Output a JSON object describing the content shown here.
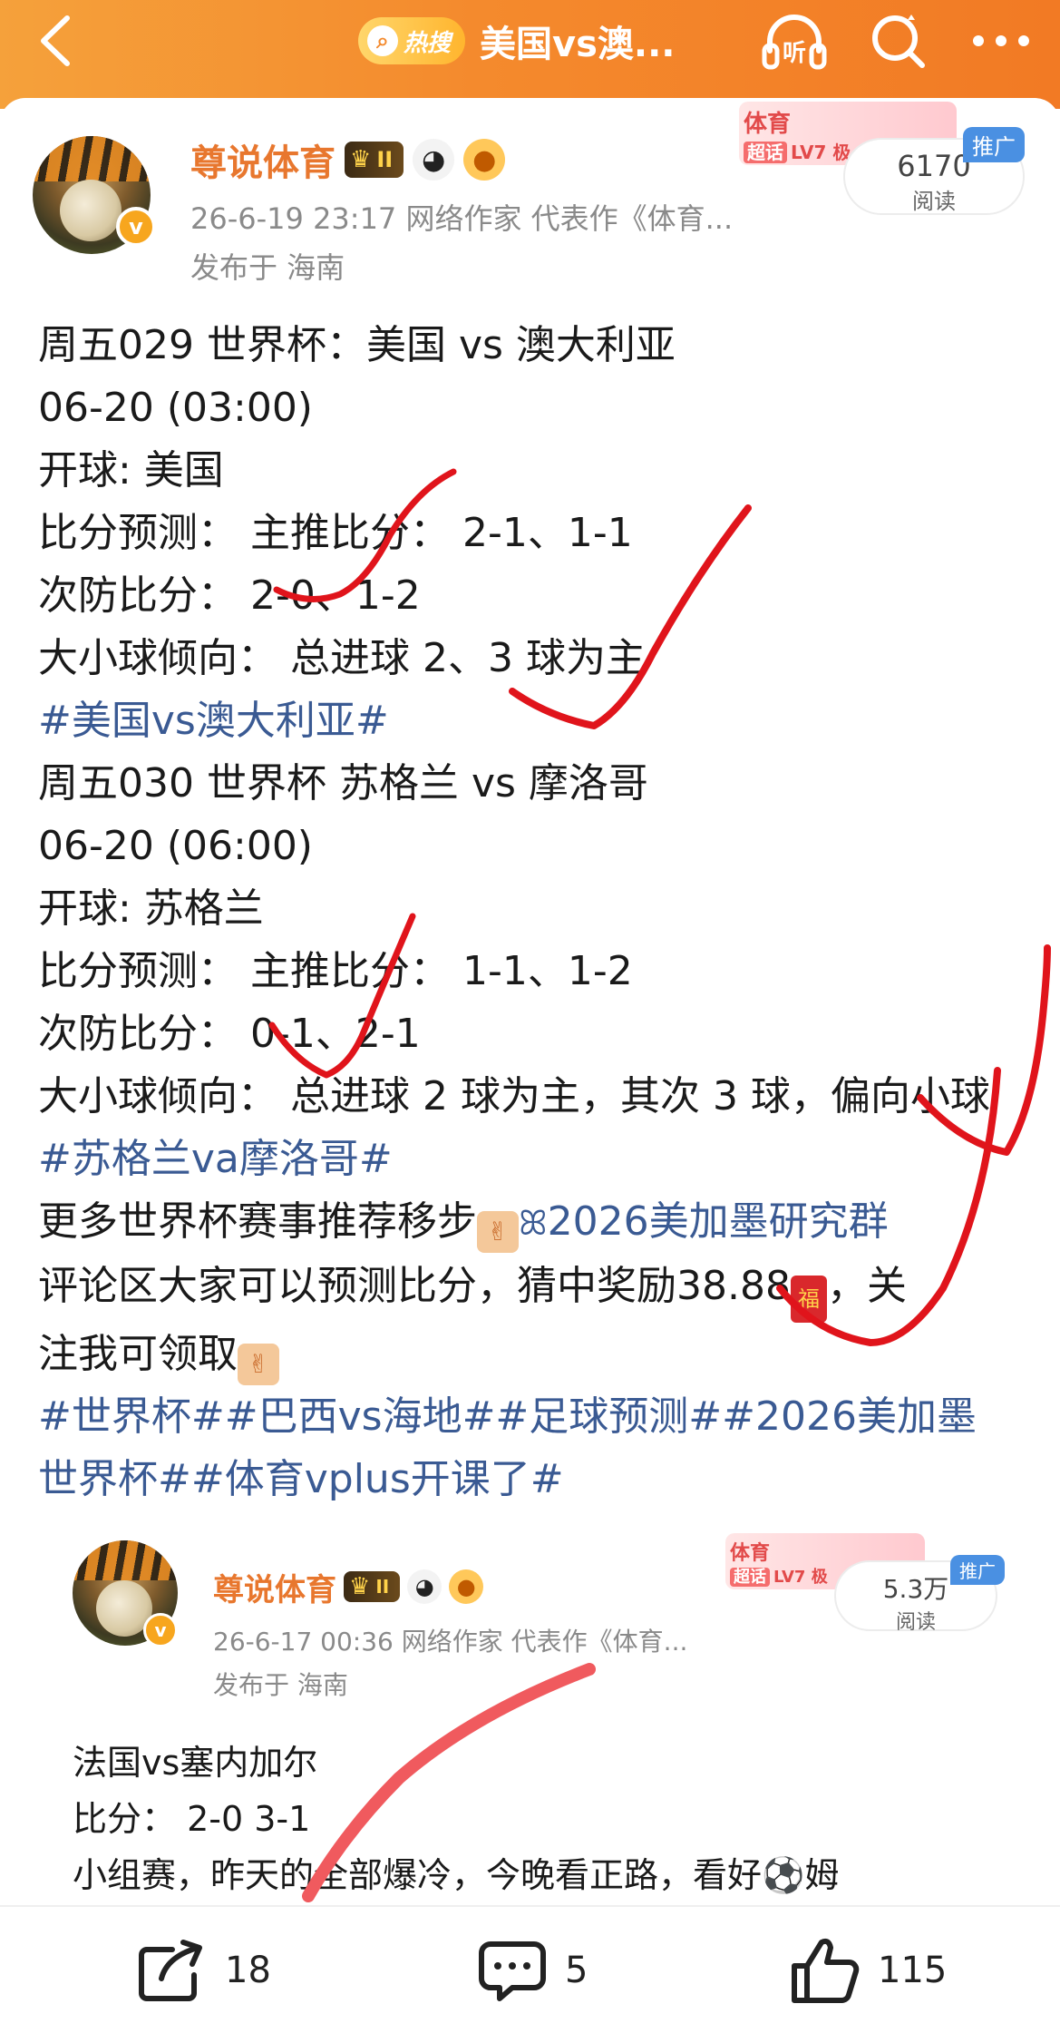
{
  "header": {
    "hot_badge": "热搜",
    "title": "美国vs澳...",
    "icons": [
      "back-icon",
      "listen-icon",
      "search-icon",
      "more-icon"
    ],
    "listen_label": "听"
  },
  "post": {
    "author": "尊说体育",
    "level_badge": "II",
    "meta": "26-6-19 23:17  网络作家 代表作《体育...",
    "location": "发布于 海南",
    "ad": {
      "label": "体育",
      "sub_chip": "超话",
      "sub_text": "LV7 极",
      "reads": "6170",
      "reads_label": "阅读",
      "promo": "推广"
    },
    "lines": [
      "周五029 世界杯：美国 vs 澳大利亚",
      "06-20 (03:00)",
      "开球: 美国",
      "比分预测：  主推比分：  2-1、1-1",
      "次防比分：  2-0、1-2",
      "大小球倾向：  总进球 2、3 球为主"
    ],
    "tag1": "#美国vs澳大利亚#",
    "lines2": [
      "周五030 世界杯 苏格兰 vs 摩洛哥",
      "06-20 (06:00)",
      "开球: 苏格兰",
      "比分预测：  主推比分：  1-1、1-2",
      "次防比分：  0-1、2-1",
      "大小球倾向：  总进球 2 球为主，其次 3 球，偏向小球"
    ],
    "tag2": "#苏格兰va摩洛哥#",
    "more_text": "更多世界杯赛事推荐移步",
    "group_link": "2026美加墨研究群",
    "reward_text_1": "评论区大家可以预测比分，猜中奖励38.88",
    "reward_text_2": "，关",
    "reward_text_3": "注我可领取",
    "tags_line1": "#世界杯##巴西vs海地##足球预测##2026美加墨",
    "tags_line2": "世界杯##体育vplus开课了#"
  },
  "embed": {
    "author": "尊说体育",
    "level_badge": "II",
    "meta": "26-6-17 00:36  网络作家 代表作《体育...",
    "location": "发布于 海南",
    "ad": {
      "label": "体育",
      "sub_chip": "超话",
      "sub_text": "LV7 极",
      "reads": "5.3万",
      "reads_label": "阅读",
      "promo": "推广"
    },
    "lines": [
      "法国vs塞内加尔",
      "比分：  2-0 3-1",
      "小组赛，昨天的全部爆冷，今晚看正路，看好⚽姆"
    ]
  },
  "actions": {
    "share_count": "18",
    "comment_count": "5",
    "like_count": "115"
  },
  "colors": {
    "topbar": "#f48a2d",
    "author": "#e8772e",
    "tag": "#3a5a93",
    "ink": "#e0141b"
  }
}
